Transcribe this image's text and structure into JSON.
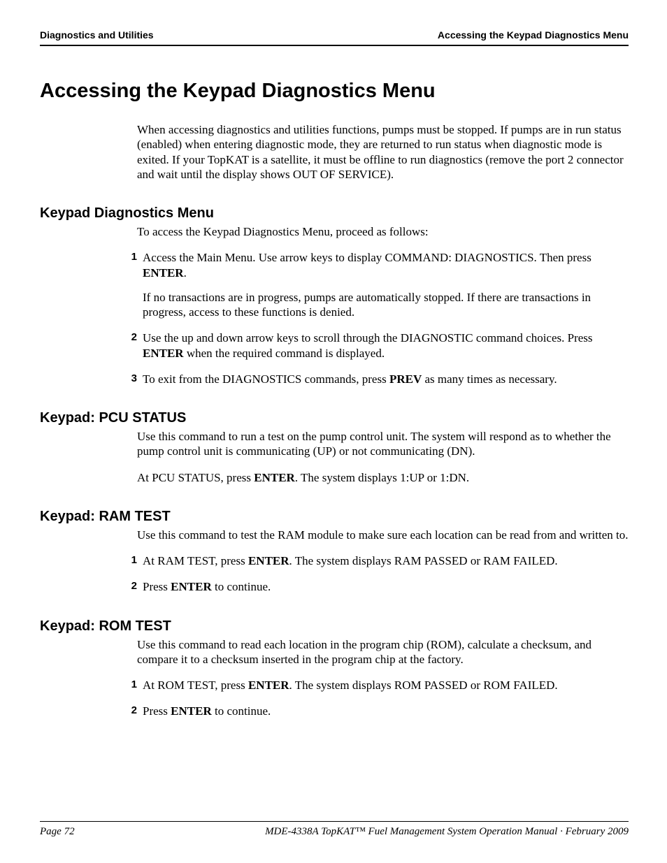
{
  "header": {
    "left": "Diagnostics and Utilities",
    "right": "Accessing the Keypad Diagnostics Menu"
  },
  "title": "Accessing the Keypad Diagnostics Menu",
  "intro": "When accessing diagnostics and utilities functions, pumps must be stopped. If pumps are in run status (enabled) when entering diagnostic mode, they are returned to run status when diagnostic mode is exited. If your TopKAT is a satellite, it must be offline to run diagnostics (remove the port 2 connector and wait until the display shows OUT OF SERVICE).",
  "sections": {
    "kdm": {
      "heading": "Keypad Diagnostics Menu",
      "lead": "To access the Keypad Diagnostics Menu, proceed as follows:",
      "items": {
        "1": {
          "num": "1",
          "pre": "Access the Main Menu. Use arrow keys to display COMMAND: DIAGNOSTICS. Then press ",
          "bold": "ENTER",
          "post": ".",
          "extra": "If no transactions are in progress, pumps are automatically stopped. If there are transactions in progress, access to these functions is denied."
        },
        "2": {
          "num": "2",
          "pre": "Use the up and down arrow keys to scroll through the DIAGNOSTIC command choices. Press ",
          "bold": "ENTER",
          "post": " when the required command is displayed."
        },
        "3": {
          "num": "3",
          "pre": "To exit from the DIAGNOSTICS commands, press ",
          "bold": "PREV",
          "post": " as many times as necessary."
        }
      }
    },
    "pcu": {
      "heading": "Keypad: PCU STATUS",
      "p1": "Use this command to run a test on the pump control unit. The system will respond as to whether the pump control unit is communicating (UP) or not communicating (DN).",
      "p2_pre": "At PCU STATUS, press ",
      "p2_bold": "ENTER",
      "p2_post": ". The system displays 1:UP or 1:DN."
    },
    "ram": {
      "heading": "Keypad: RAM TEST",
      "lead": "Use this command to test the RAM module to make sure each location can be read from and written to.",
      "items": {
        "1": {
          "num": "1",
          "pre": "At RAM TEST, press ",
          "bold": "ENTER",
          "post": ". The system displays RAM PASSED or RAM FAILED."
        },
        "2": {
          "num": "2",
          "pre": "Press ",
          "bold": "ENTER",
          "post": " to continue."
        }
      }
    },
    "rom": {
      "heading": "Keypad: ROM TEST",
      "lead": "Use this command to read each location in the program chip (ROM), calculate a checksum, and compare it to a checksum inserted in the program chip at the factory.",
      "items": {
        "1": {
          "num": "1",
          "pre": "At ROM TEST, press ",
          "bold": "ENTER",
          "post": ". The system displays ROM PASSED or ROM FAILED."
        },
        "2": {
          "num": "2",
          "pre": "Press ",
          "bold": "ENTER",
          "post": " to continue."
        }
      }
    }
  },
  "footer": {
    "page": "Page 72",
    "doc": "MDE-4338A TopKAT™ Fuel Management System Operation Manual · February 2009"
  }
}
